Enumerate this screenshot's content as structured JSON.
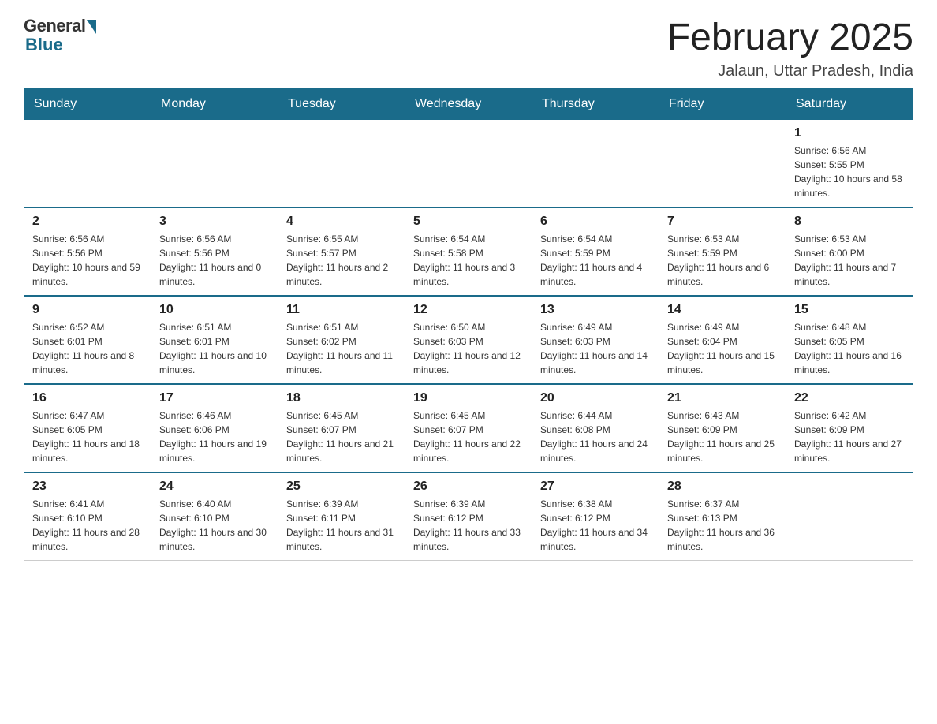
{
  "header": {
    "logo_general": "General",
    "logo_blue": "Blue",
    "title": "February 2025",
    "location": "Jalaun, Uttar Pradesh, India"
  },
  "weekdays": [
    "Sunday",
    "Monday",
    "Tuesday",
    "Wednesday",
    "Thursday",
    "Friday",
    "Saturday"
  ],
  "weeks": [
    [
      {
        "day": "",
        "sunrise": "",
        "sunset": "",
        "daylight": ""
      },
      {
        "day": "",
        "sunrise": "",
        "sunset": "",
        "daylight": ""
      },
      {
        "day": "",
        "sunrise": "",
        "sunset": "",
        "daylight": ""
      },
      {
        "day": "",
        "sunrise": "",
        "sunset": "",
        "daylight": ""
      },
      {
        "day": "",
        "sunrise": "",
        "sunset": "",
        "daylight": ""
      },
      {
        "day": "",
        "sunrise": "",
        "sunset": "",
        "daylight": ""
      },
      {
        "day": "1",
        "sunrise": "Sunrise: 6:56 AM",
        "sunset": "Sunset: 5:55 PM",
        "daylight": "Daylight: 10 hours and 58 minutes."
      }
    ],
    [
      {
        "day": "2",
        "sunrise": "Sunrise: 6:56 AM",
        "sunset": "Sunset: 5:56 PM",
        "daylight": "Daylight: 10 hours and 59 minutes."
      },
      {
        "day": "3",
        "sunrise": "Sunrise: 6:56 AM",
        "sunset": "Sunset: 5:56 PM",
        "daylight": "Daylight: 11 hours and 0 minutes."
      },
      {
        "day": "4",
        "sunrise": "Sunrise: 6:55 AM",
        "sunset": "Sunset: 5:57 PM",
        "daylight": "Daylight: 11 hours and 2 minutes."
      },
      {
        "day": "5",
        "sunrise": "Sunrise: 6:54 AM",
        "sunset": "Sunset: 5:58 PM",
        "daylight": "Daylight: 11 hours and 3 minutes."
      },
      {
        "day": "6",
        "sunrise": "Sunrise: 6:54 AM",
        "sunset": "Sunset: 5:59 PM",
        "daylight": "Daylight: 11 hours and 4 minutes."
      },
      {
        "day": "7",
        "sunrise": "Sunrise: 6:53 AM",
        "sunset": "Sunset: 5:59 PM",
        "daylight": "Daylight: 11 hours and 6 minutes."
      },
      {
        "day": "8",
        "sunrise": "Sunrise: 6:53 AM",
        "sunset": "Sunset: 6:00 PM",
        "daylight": "Daylight: 11 hours and 7 minutes."
      }
    ],
    [
      {
        "day": "9",
        "sunrise": "Sunrise: 6:52 AM",
        "sunset": "Sunset: 6:01 PM",
        "daylight": "Daylight: 11 hours and 8 minutes."
      },
      {
        "day": "10",
        "sunrise": "Sunrise: 6:51 AM",
        "sunset": "Sunset: 6:01 PM",
        "daylight": "Daylight: 11 hours and 10 minutes."
      },
      {
        "day": "11",
        "sunrise": "Sunrise: 6:51 AM",
        "sunset": "Sunset: 6:02 PM",
        "daylight": "Daylight: 11 hours and 11 minutes."
      },
      {
        "day": "12",
        "sunrise": "Sunrise: 6:50 AM",
        "sunset": "Sunset: 6:03 PM",
        "daylight": "Daylight: 11 hours and 12 minutes."
      },
      {
        "day": "13",
        "sunrise": "Sunrise: 6:49 AM",
        "sunset": "Sunset: 6:03 PM",
        "daylight": "Daylight: 11 hours and 14 minutes."
      },
      {
        "day": "14",
        "sunrise": "Sunrise: 6:49 AM",
        "sunset": "Sunset: 6:04 PM",
        "daylight": "Daylight: 11 hours and 15 minutes."
      },
      {
        "day": "15",
        "sunrise": "Sunrise: 6:48 AM",
        "sunset": "Sunset: 6:05 PM",
        "daylight": "Daylight: 11 hours and 16 minutes."
      }
    ],
    [
      {
        "day": "16",
        "sunrise": "Sunrise: 6:47 AM",
        "sunset": "Sunset: 6:05 PM",
        "daylight": "Daylight: 11 hours and 18 minutes."
      },
      {
        "day": "17",
        "sunrise": "Sunrise: 6:46 AM",
        "sunset": "Sunset: 6:06 PM",
        "daylight": "Daylight: 11 hours and 19 minutes."
      },
      {
        "day": "18",
        "sunrise": "Sunrise: 6:45 AM",
        "sunset": "Sunset: 6:07 PM",
        "daylight": "Daylight: 11 hours and 21 minutes."
      },
      {
        "day": "19",
        "sunrise": "Sunrise: 6:45 AM",
        "sunset": "Sunset: 6:07 PM",
        "daylight": "Daylight: 11 hours and 22 minutes."
      },
      {
        "day": "20",
        "sunrise": "Sunrise: 6:44 AM",
        "sunset": "Sunset: 6:08 PM",
        "daylight": "Daylight: 11 hours and 24 minutes."
      },
      {
        "day": "21",
        "sunrise": "Sunrise: 6:43 AM",
        "sunset": "Sunset: 6:09 PM",
        "daylight": "Daylight: 11 hours and 25 minutes."
      },
      {
        "day": "22",
        "sunrise": "Sunrise: 6:42 AM",
        "sunset": "Sunset: 6:09 PM",
        "daylight": "Daylight: 11 hours and 27 minutes."
      }
    ],
    [
      {
        "day": "23",
        "sunrise": "Sunrise: 6:41 AM",
        "sunset": "Sunset: 6:10 PM",
        "daylight": "Daylight: 11 hours and 28 minutes."
      },
      {
        "day": "24",
        "sunrise": "Sunrise: 6:40 AM",
        "sunset": "Sunset: 6:10 PM",
        "daylight": "Daylight: 11 hours and 30 minutes."
      },
      {
        "day": "25",
        "sunrise": "Sunrise: 6:39 AM",
        "sunset": "Sunset: 6:11 PM",
        "daylight": "Daylight: 11 hours and 31 minutes."
      },
      {
        "day": "26",
        "sunrise": "Sunrise: 6:39 AM",
        "sunset": "Sunset: 6:12 PM",
        "daylight": "Daylight: 11 hours and 33 minutes."
      },
      {
        "day": "27",
        "sunrise": "Sunrise: 6:38 AM",
        "sunset": "Sunset: 6:12 PM",
        "daylight": "Daylight: 11 hours and 34 minutes."
      },
      {
        "day": "28",
        "sunrise": "Sunrise: 6:37 AM",
        "sunset": "Sunset: 6:13 PM",
        "daylight": "Daylight: 11 hours and 36 minutes."
      },
      {
        "day": "",
        "sunrise": "",
        "sunset": "",
        "daylight": ""
      }
    ]
  ]
}
